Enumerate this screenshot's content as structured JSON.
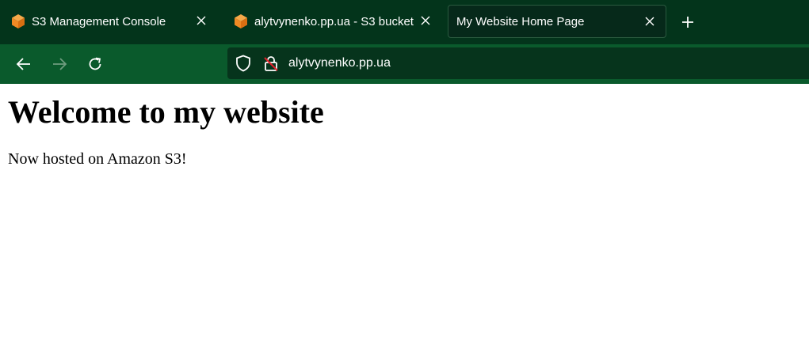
{
  "browser": {
    "tabs": [
      {
        "title": "S3 Management Console",
        "icon": "aws-s3-cube-icon",
        "active": false
      },
      {
        "title": "alytvynenko.pp.ua - S3 bucket",
        "icon": "aws-s3-cube-icon",
        "active": false
      },
      {
        "title": "My Website Home Page",
        "icon": "",
        "active": true
      }
    ],
    "close_glyph": "×",
    "new_tab_glyph": "+",
    "url": "alytvynenko.pp.ua"
  },
  "page": {
    "heading": "Welcome to my website",
    "paragraph": "Now hosted on Amazon S3!"
  },
  "colors": {
    "tab_bar": "#03341b",
    "toolbar": "#0a5a2c",
    "url_bar": "#06341c",
    "active_tab": "#06291a",
    "s3_orange": "#f08a24",
    "insecure_slash": "#e0202a"
  }
}
